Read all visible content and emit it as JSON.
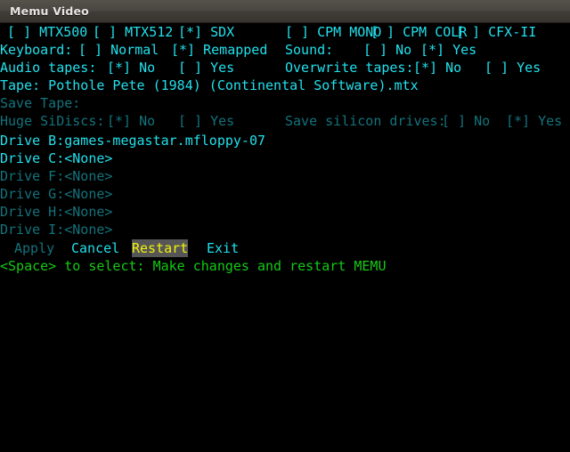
{
  "window": {
    "title": "Memu Video"
  },
  "colors": {
    "background": "#000000",
    "bright_cyan": "#22e0ec",
    "dim_cyan": "#13737c",
    "green": "#16c916",
    "yellow": "#f2f20d",
    "selection_background": "#565656",
    "titlebar_text": "#e8e6e3"
  },
  "machine_row": {
    "options": [
      {
        "label": "MTX500",
        "marker": "[ ]",
        "checked": false,
        "text": "[ ] MTX500"
      },
      {
        "label": "MTX512",
        "marker": "[ ]",
        "checked": false,
        "text": "[ ] MTX512"
      },
      {
        "label": "SDX",
        "marker": "[*]",
        "checked": true,
        "text": "[*] SDX"
      },
      {
        "label": "CPM MONO",
        "marker": "[ ]",
        "checked": false,
        "text": "[ ] CPM MONO"
      },
      {
        "label": "CPM COLR",
        "marker": "[ ]",
        "checked": false,
        "text": "[ ] CPM COLR"
      },
      {
        "label": "CFX-II",
        "marker": "[ ]",
        "checked": false,
        "text": "[ ] CFX-II"
      }
    ]
  },
  "keyboard_row": {
    "label": "Keyboard:",
    "normal": "[ ] Normal",
    "remapped": "[*] Remapped"
  },
  "sound_row": {
    "label": "Sound:",
    "no": "[ ] No",
    "yes": "[*] Yes"
  },
  "audio_tapes_row": {
    "label": "Audio tapes:",
    "no": "[*] No",
    "yes": "[ ] Yes"
  },
  "overwrite_tapes_row": {
    "label": "Overwrite tapes:",
    "no": "[*] No",
    "yes": "[ ] Yes"
  },
  "tape_row": {
    "text": "Tape: Pothole Pete (1984) (Continental Software).mtx"
  },
  "save_tape_row": {
    "text": "Save Tape:"
  },
  "huge_sidiscs_row": {
    "label": "Huge SiDiscs:",
    "no": "[*] No",
    "yes": "[ ] Yes"
  },
  "save_silicon_drives_row": {
    "label": "Save silicon drives:",
    "no": "[ ] No",
    "yes": "[*] Yes"
  },
  "drives": [
    {
      "text": "Drive B:games-megastar.mfloppy-07",
      "enabled": true
    },
    {
      "text": "Drive C:<None>",
      "enabled": true
    },
    {
      "text": "Drive F:<None>",
      "enabled": false
    },
    {
      "text": "Drive G:<None>",
      "enabled": false
    },
    {
      "text": "Drive H:<None>",
      "enabled": false
    },
    {
      "text": "Drive I:<None>",
      "enabled": false
    }
  ],
  "buttons": {
    "apply": "Apply",
    "cancel": "Cancel",
    "restart": "Restart",
    "exit": "Exit"
  },
  "status_line": {
    "text": "<Space> to select: Make changes and restart MEMU"
  }
}
